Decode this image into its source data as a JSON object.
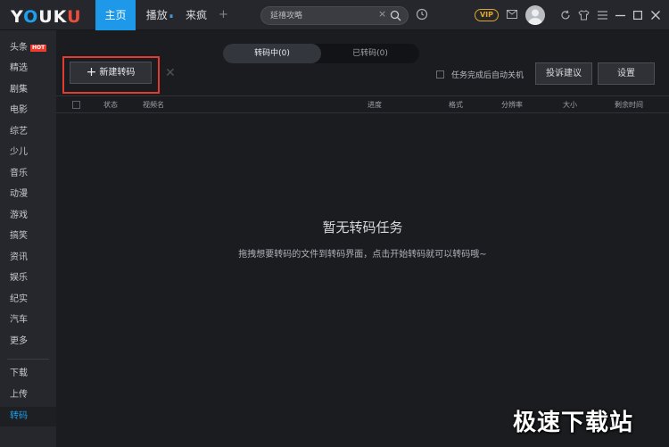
{
  "header": {
    "logo": "YOUKU",
    "tabs": [
      {
        "label": "主页",
        "active": true
      },
      {
        "label": "播放",
        "active": false
      },
      {
        "label": "来疯",
        "active": false
      }
    ],
    "play_indicator": "⏸",
    "add_tab": "+",
    "search_placeholder": "延禧攻略",
    "vip": "VIP"
  },
  "sidebar": {
    "items": [
      {
        "label": "头条",
        "badge": "HOT"
      },
      {
        "label": "精选"
      },
      {
        "label": "剧集"
      },
      {
        "label": "电影"
      },
      {
        "label": "综艺"
      },
      {
        "label": "少儿"
      },
      {
        "label": "音乐"
      },
      {
        "label": "动漫"
      },
      {
        "label": "游戏"
      },
      {
        "label": "搞笑"
      },
      {
        "label": "资讯"
      },
      {
        "label": "娱乐"
      },
      {
        "label": "纪实"
      },
      {
        "label": "汽车"
      },
      {
        "label": "更多"
      }
    ],
    "bottom_items": [
      {
        "label": "下载"
      },
      {
        "label": "上传"
      },
      {
        "label": "转码",
        "active": true
      }
    ]
  },
  "main": {
    "toggle": {
      "converting": "转码中(0)",
      "converted": "已转码(0)"
    },
    "new_button": "新建转码",
    "auto_shutdown": "任务完成后自动关机",
    "feedback_button": "投诉建议",
    "settings_button": "设置",
    "columns": [
      "状态",
      "视频名",
      "进度",
      "格式",
      "分辨率",
      "大小",
      "剩余时间"
    ],
    "empty_title": "暂无转码任务",
    "empty_desc": "拖拽想要转码的文件到转码界面，点击开始转码就可以转码哦~"
  },
  "watermark": "极速下载站",
  "colors": {
    "accent": "#1e98e8",
    "highlight": "#e03c31",
    "vip": "#e0a826"
  }
}
